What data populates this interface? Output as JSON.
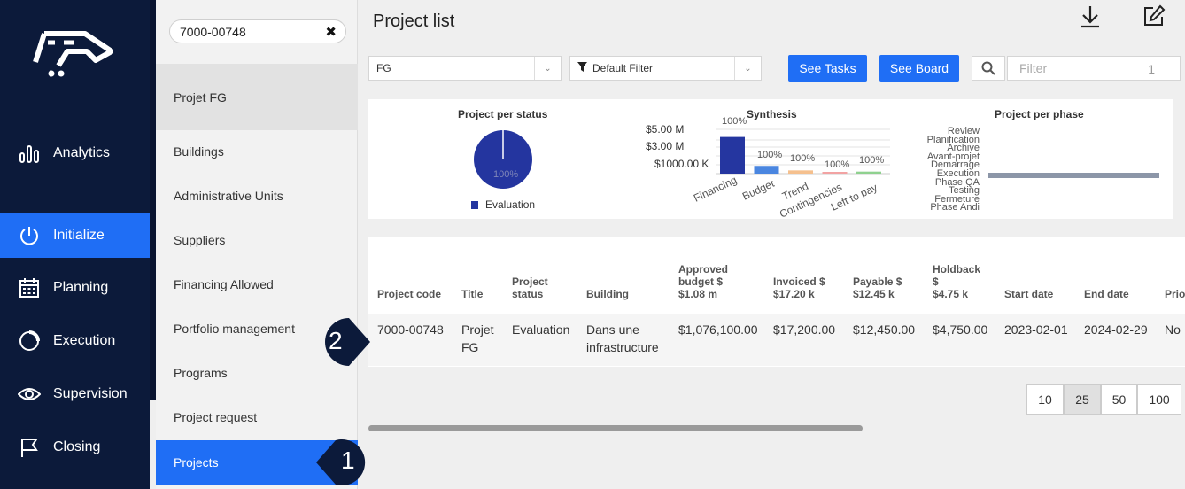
{
  "nav": {
    "items": [
      {
        "label": "Analytics",
        "icon": "bar-chart-icon"
      },
      {
        "label": "Initialize",
        "icon": "power-icon",
        "active": true
      },
      {
        "label": "Planning",
        "icon": "calendar-icon"
      },
      {
        "label": "Execution",
        "icon": "progress-circle-icon"
      },
      {
        "label": "Supervision",
        "icon": "eye-icon"
      },
      {
        "label": "Closing",
        "icon": "flag-icon"
      }
    ]
  },
  "panel": {
    "search_value": "7000-00748",
    "selected_project": "Projet FG",
    "items": [
      "Buildings",
      "Administrative Units",
      "Suppliers",
      "Financing Allowed",
      "Portfolio management",
      "Programs",
      "Project request",
      "Projects"
    ]
  },
  "main": {
    "title": "Project list",
    "project_select": "FG",
    "filter_select": "Default Filter",
    "see_tasks": "See Tasks",
    "see_board": "See Board",
    "filter_placeholder": "Filter",
    "filter_count": "1"
  },
  "charts": {
    "status": {
      "title": "Project per status",
      "slice_label": "100%",
      "legend": "Evaluation"
    },
    "synthesis": {
      "title": "Synthesis",
      "y_ticks": [
        "$5.00 M",
        "$3.00 M",
        "$1000.00 K"
      ],
      "bar_labels": [
        "100%",
        "100%",
        "100%",
        "100%",
        "100%"
      ],
      "categories": [
        "Financing",
        "Budget",
        "Trend",
        "Contingencies",
        "Left to pay"
      ]
    },
    "phase": {
      "title": "Project per phase",
      "categories": [
        "Review",
        "Planification",
        "Archive",
        "Avant-projet",
        "Demarrage",
        "Execution",
        "Phase QA",
        "Testing",
        "Fermeture",
        "Phase Andi"
      ]
    }
  },
  "chart_data": [
    {
      "type": "pie",
      "title": "Project per status",
      "categories": [
        "Evaluation"
      ],
      "values": [
        100
      ]
    },
    {
      "type": "bar",
      "title": "Synthesis",
      "categories": [
        "Financing",
        "Budget",
        "Trend",
        "Contingencies",
        "Left to pay"
      ],
      "values": [
        1076100,
        228000,
        95000,
        30000,
        60000
      ],
      "bar_labels": [
        "100%",
        "100%",
        "100%",
        "100%",
        "100%"
      ],
      "ylim": [
        0,
        1300000
      ],
      "colors": [
        "#2536a0",
        "#4a86e0",
        "#f5c08e",
        "#f2a3a3",
        "#8fd18f"
      ]
    },
    {
      "type": "bar",
      "title": "Project per phase",
      "categories": [
        "Review",
        "Planification",
        "Archive",
        "Avant-projet",
        "Demarrage",
        "Execution",
        "Phase QA",
        "Testing",
        "Fermeture",
        "Phase Andi"
      ]
    }
  ],
  "table": {
    "headers": [
      {
        "lines": [
          "Project code"
        ]
      },
      {
        "lines": [
          "Title"
        ]
      },
      {
        "lines": [
          "Project",
          "status"
        ]
      },
      {
        "lines": [
          "Building"
        ]
      },
      {
        "lines": [
          "Approved",
          "budget $",
          "$1.08 m"
        ]
      },
      {
        "lines": [
          "Invoiced $",
          "$17.20 k"
        ]
      },
      {
        "lines": [
          "Payable $",
          "$12.45 k"
        ]
      },
      {
        "lines": [
          "Holdback",
          "$",
          "$4.75 k"
        ]
      },
      {
        "lines": [
          "Start date"
        ]
      },
      {
        "lines": [
          "End date"
        ]
      },
      {
        "lines": [
          "Prio"
        ]
      }
    ],
    "row": [
      [
        "7000-00748"
      ],
      [
        "Projet",
        "FG"
      ],
      [
        "Evaluation"
      ],
      [
        "Dans une",
        "infrastructure"
      ],
      [
        "$1,076,100.00"
      ],
      [
        "$17,200.00"
      ],
      [
        "$12,450.00"
      ],
      [
        "$4,750.00"
      ],
      [
        "2023-02-01"
      ],
      [
        "2024-02-29"
      ],
      [
        "No"
      ]
    ]
  },
  "pagination": [
    "10",
    "25",
    "50",
    "100"
  ],
  "callouts": [
    "1",
    "2"
  ],
  "colors": {
    "nav_bg": "#0c1a3a",
    "accent": "#1f6ef5"
  }
}
